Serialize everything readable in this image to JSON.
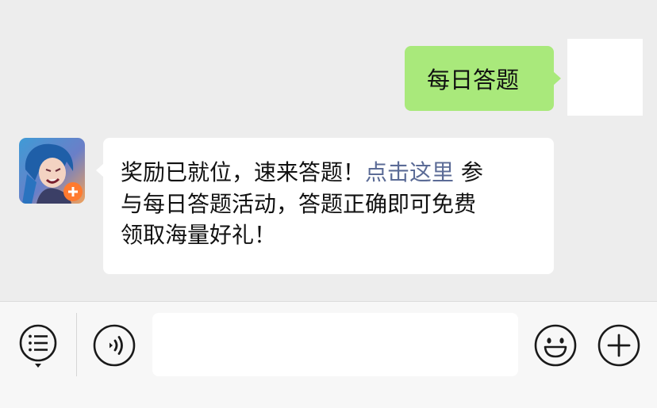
{
  "chat": {
    "outgoing": [
      {
        "text": "每日答题"
      }
    ],
    "incoming": [
      {
        "avatar_icon": "game-character-icon",
        "line1_before_link": "奖励已就位，速来答题！",
        "link_text": "点击这里",
        "line1_after_link": " 参",
        "line2": "与每日答题活动，答题正确即可免费",
        "line3": "领取海量好礼！"
      }
    ]
  },
  "input_bar": {
    "menu_icon": "menu-list-icon",
    "voice_icon": "voice-icon",
    "emoji_icon": "emoji-icon",
    "add_icon": "plus-icon",
    "input_value": ""
  },
  "colors": {
    "background": "#ededed",
    "outgoing_bubble": "#a9e97b",
    "incoming_bubble": "#ffffff",
    "link": "#5b6b96"
  }
}
